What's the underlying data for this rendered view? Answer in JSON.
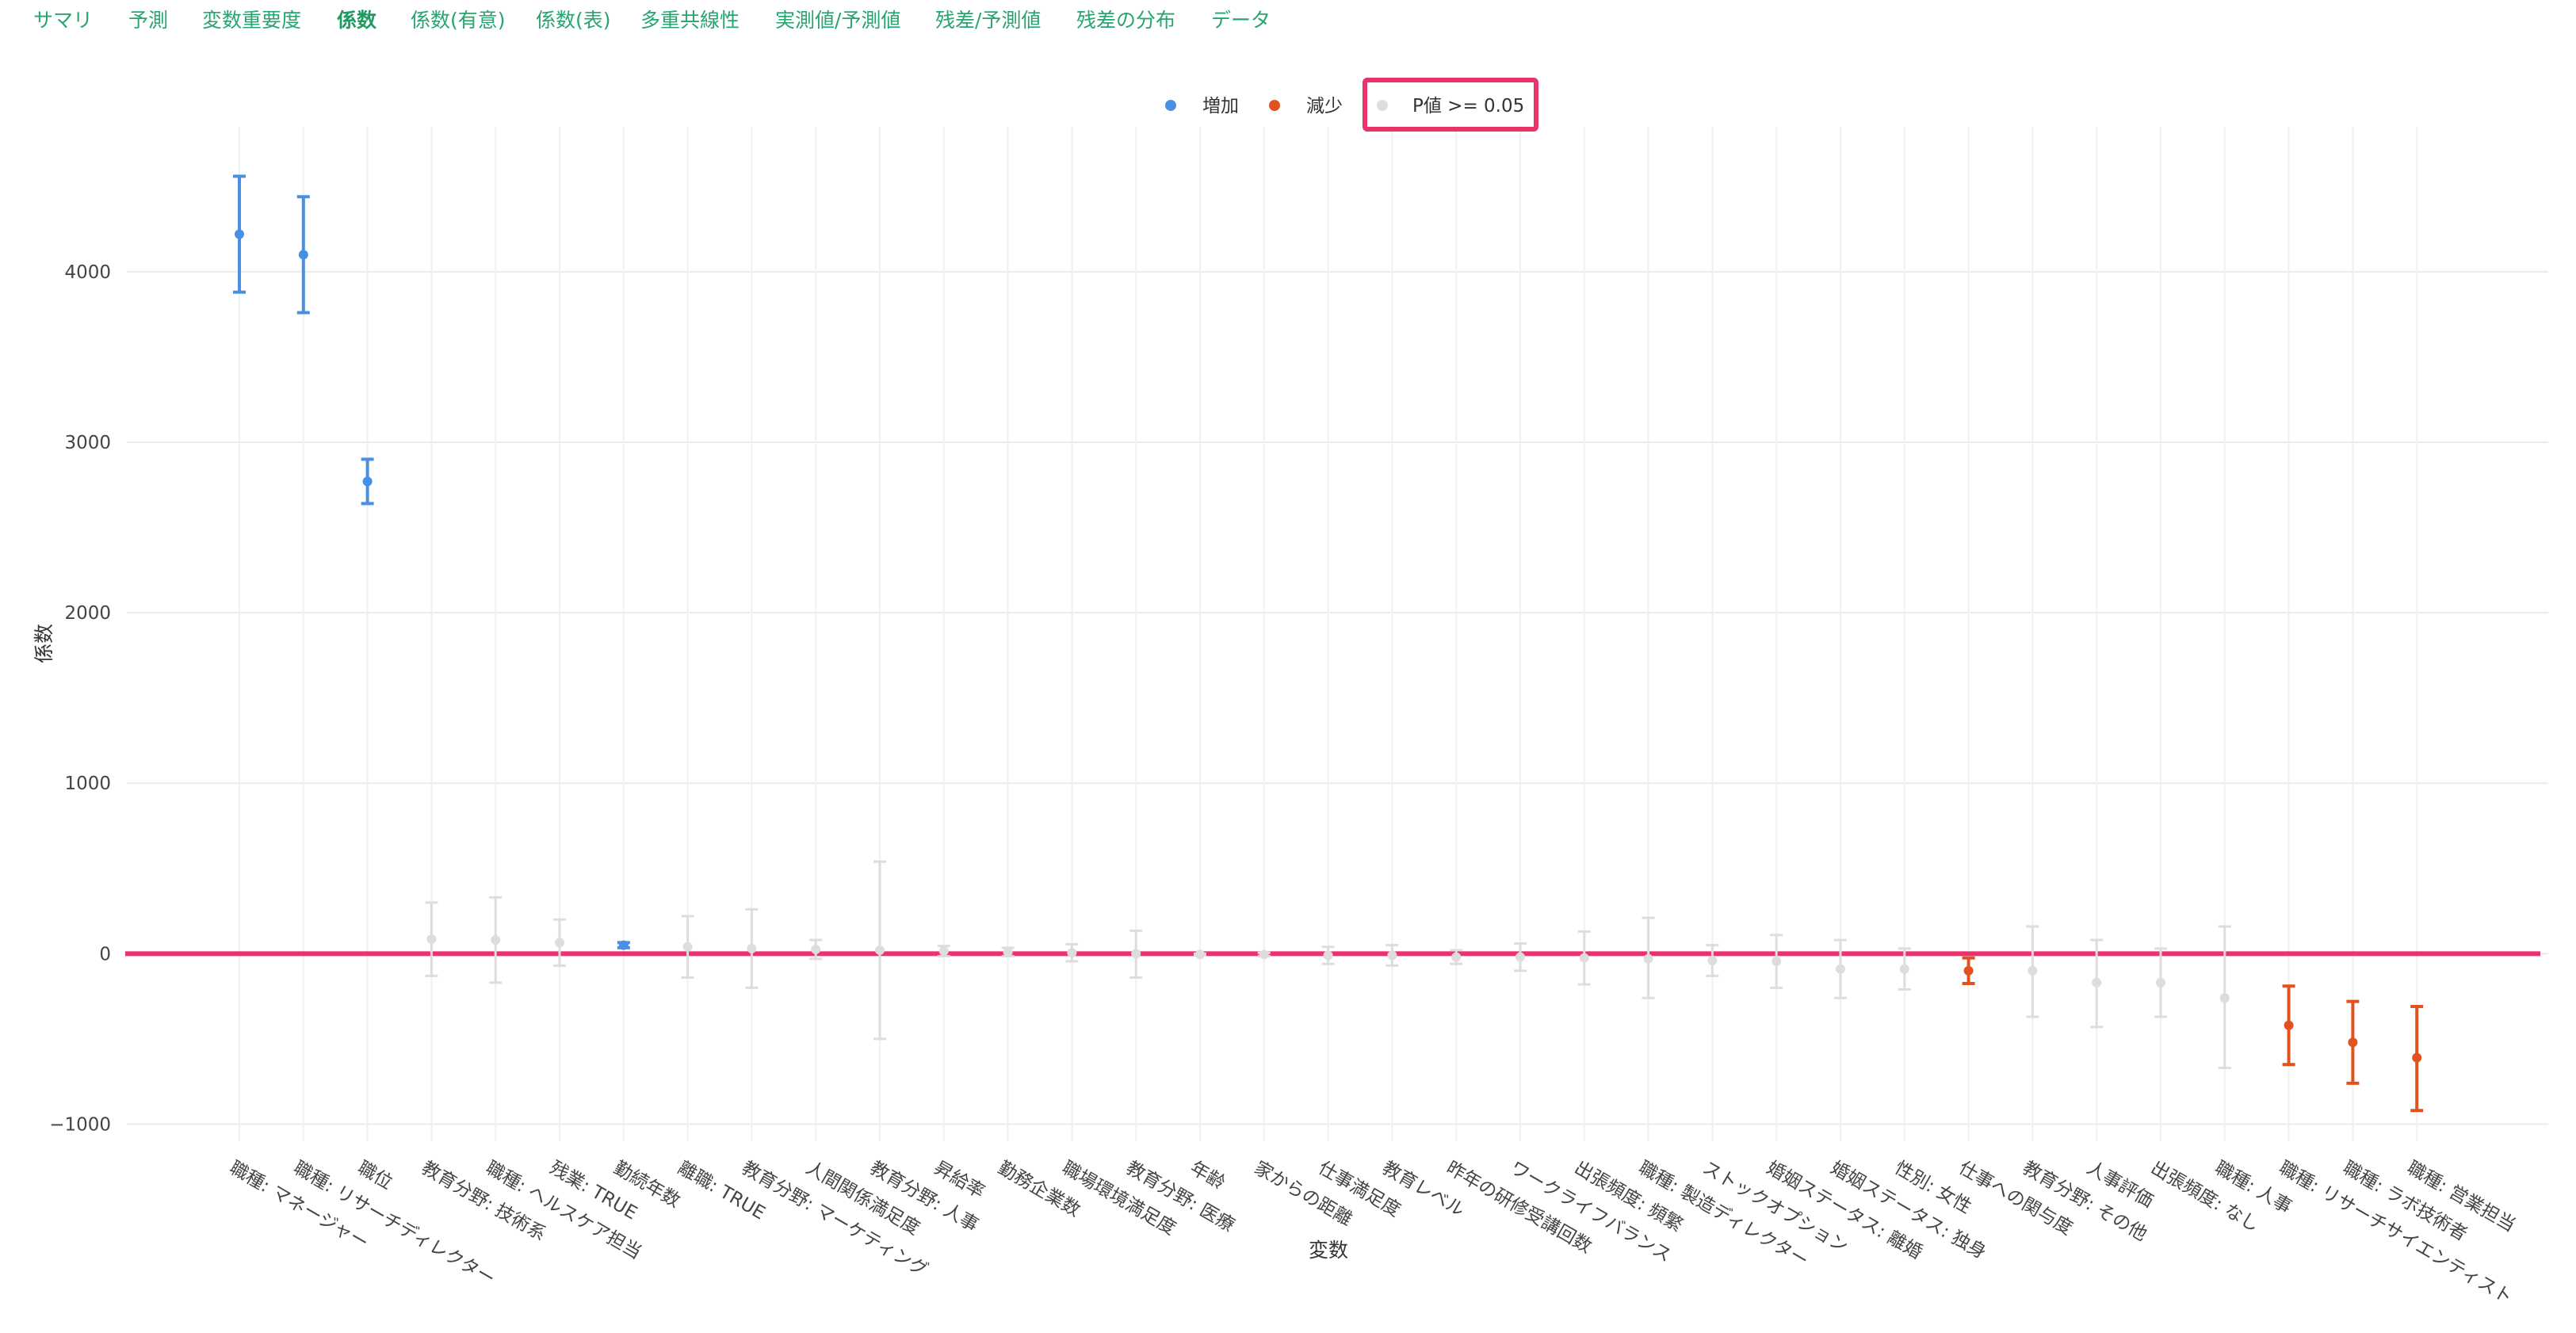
{
  "tabs": [
    {
      "label": "サマリ",
      "active": false
    },
    {
      "label": "予測",
      "active": false
    },
    {
      "label": "変数重要度",
      "active": false
    },
    {
      "label": "係数",
      "active": true
    },
    {
      "label": "係数(有意)",
      "active": false
    },
    {
      "label": "係数(表)",
      "active": false
    },
    {
      "label": "多重共線性",
      "active": false
    },
    {
      "label": "実測値/予測値",
      "active": false
    },
    {
      "label": "残差/予測値",
      "active": false
    },
    {
      "label": "残差の分布",
      "active": false
    },
    {
      "label": "データ",
      "active": false
    }
  ],
  "colors": {
    "increase": "#4a90e2",
    "decrease": "#e0531f",
    "insignificant": "#dddddd",
    "zero_line": "#f0306e",
    "highlight_box": "#e8336b",
    "tab": "#27a56e"
  },
  "chart_data": {
    "type": "scatter",
    "xlabel": "変数",
    "ylabel": "係数",
    "ylim": [
      -1100,
      4850
    ],
    "yticks": [
      -1000,
      0,
      1000,
      2000,
      3000,
      4000
    ],
    "grid": true,
    "legend_position": "top-center",
    "legend": [
      {
        "key": "increase",
        "label": "増加",
        "color": "#4a90e2"
      },
      {
        "key": "decrease",
        "label": "減少",
        "color": "#e0531f"
      },
      {
        "key": "insignificant",
        "label": "P値 >= 0.05",
        "color": "#dddddd",
        "highlighted": true
      }
    ],
    "zero_line": 0,
    "points": [
      {
        "label": "職種: マネージャー",
        "value": 4220,
        "low": 3880,
        "high": 4560,
        "group": "increase"
      },
      {
        "label": "職種: リサーチディレクター",
        "value": 4100,
        "low": 3760,
        "high": 4440,
        "group": "increase"
      },
      {
        "label": "職位",
        "value": 2770,
        "low": 2640,
        "high": 2900,
        "group": "increase"
      },
      {
        "label": "教育分野: 技術系",
        "value": 85,
        "low": -130,
        "high": 300,
        "group": "insignificant"
      },
      {
        "label": "職種: ヘルスケア担当",
        "value": 80,
        "low": -170,
        "high": 330,
        "group": "insignificant"
      },
      {
        "label": "残業: TRUE",
        "value": 65,
        "low": -70,
        "high": 200,
        "group": "insignificant"
      },
      {
        "label": "勤続年数",
        "value": 50,
        "low": 35,
        "high": 65,
        "group": "increase"
      },
      {
        "label": "離職: TRUE",
        "value": 40,
        "low": -140,
        "high": 220,
        "group": "insignificant"
      },
      {
        "label": "教育分野: マーケティング",
        "value": 30,
        "low": -200,
        "high": 260,
        "group": "insignificant"
      },
      {
        "label": "人間関係満足度",
        "value": 25,
        "low": -30,
        "high": 80,
        "group": "insignificant"
      },
      {
        "label": "教育分野: 人事",
        "value": 20,
        "low": -500,
        "high": 540,
        "group": "insignificant"
      },
      {
        "label": "昇給率",
        "value": 15,
        "low": -15,
        "high": 45,
        "group": "insignificant"
      },
      {
        "label": "勤務企業数",
        "value": 10,
        "low": -15,
        "high": 35,
        "group": "insignificant"
      },
      {
        "label": "職場環境満足度",
        "value": 5,
        "low": -45,
        "high": 55,
        "group": "insignificant"
      },
      {
        "label": "教育分野: 医療",
        "value": 0,
        "low": -140,
        "high": 135,
        "group": "insignificant"
      },
      {
        "label": "年齢",
        "value": -5,
        "low": -10,
        "high": 0,
        "group": "insignificant"
      },
      {
        "label": "家からの距離",
        "value": -5,
        "low": -15,
        "high": 5,
        "group": "insignificant"
      },
      {
        "label": "仕事満足度",
        "value": -10,
        "low": -60,
        "high": 40,
        "group": "insignificant"
      },
      {
        "label": "教育レベル",
        "value": -10,
        "low": -70,
        "high": 50,
        "group": "insignificant"
      },
      {
        "label": "昨年の研修受講回数",
        "value": -20,
        "low": -60,
        "high": 20,
        "group": "insignificant"
      },
      {
        "label": "ワークライフバランス",
        "value": -20,
        "low": -100,
        "high": 60,
        "group": "insignificant"
      },
      {
        "label": "出張頻度: 頻繁",
        "value": -25,
        "low": -180,
        "high": 130,
        "group": "insignificant"
      },
      {
        "label": "職種: 製造ディレクター",
        "value": -30,
        "low": -260,
        "high": 210,
        "group": "insignificant"
      },
      {
        "label": "ストックオプション",
        "value": -40,
        "low": -130,
        "high": 50,
        "group": "insignificant"
      },
      {
        "label": "婚姻ステータス: 離婚",
        "value": -45,
        "low": -200,
        "high": 110,
        "group": "insignificant"
      },
      {
        "label": "婚姻ステータス: 独身",
        "value": -90,
        "low": -260,
        "high": 80,
        "group": "insignificant"
      },
      {
        "label": "性別: 女性",
        "value": -90,
        "low": -210,
        "high": 30,
        "group": "insignificant"
      },
      {
        "label": "仕事への関与度",
        "value": -100,
        "low": -175,
        "high": -25,
        "group": "decrease"
      },
      {
        "label": "教育分野: その他",
        "value": -100,
        "low": -370,
        "high": 160,
        "group": "insignificant"
      },
      {
        "label": "人事評価",
        "value": -170,
        "low": -430,
        "high": 80,
        "group": "insignificant"
      },
      {
        "label": "出張頻度: なし",
        "value": -170,
        "low": -370,
        "high": 30,
        "group": "insignificant"
      },
      {
        "label": "職種: 人事",
        "value": -260,
        "low": -670,
        "high": 160,
        "group": "insignificant"
      },
      {
        "label": "職種: リサーチサイエンティスト",
        "value": -420,
        "low": -650,
        "high": -190,
        "group": "decrease"
      },
      {
        "label": "職種: ラボ技術者",
        "value": -520,
        "low": -760,
        "high": -280,
        "group": "decrease"
      },
      {
        "label": "職種: 営業担当",
        "value": -610,
        "low": -920,
        "high": -310,
        "group": "decrease"
      }
    ]
  }
}
